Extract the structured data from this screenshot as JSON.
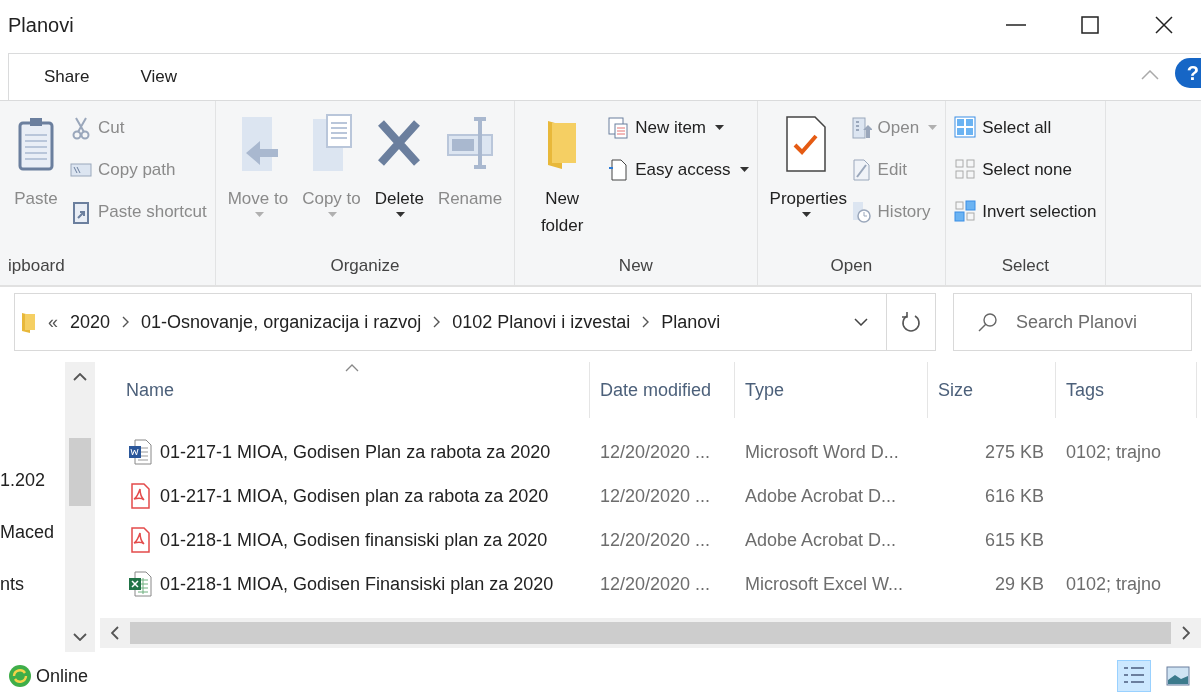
{
  "window": {
    "title": "Planovi"
  },
  "ribbon_tabs": [
    {
      "label": "Share",
      "selected": false
    },
    {
      "label": "View",
      "selected": false
    }
  ],
  "help": "?",
  "ribbon": [
    {
      "label": "ipboard",
      "items": [
        {
          "kind": "large",
          "label": "Paste",
          "disabled": true
        },
        {
          "kind": "small",
          "label": "Cut",
          "disabled": true
        },
        {
          "kind": "small",
          "label": "Copy path",
          "disabled": true
        },
        {
          "kind": "small",
          "label": "Paste shortcut",
          "disabled": true
        }
      ]
    },
    {
      "label": "Organize",
      "items": [
        {
          "kind": "large",
          "label": "Move to",
          "disabled": true,
          "dropdown": true
        },
        {
          "kind": "large",
          "label": "Copy to",
          "disabled": true,
          "dropdown": true
        },
        {
          "kind": "large",
          "label": "Delete",
          "disabled": false,
          "dropdown": true
        },
        {
          "kind": "large",
          "label": "Rename",
          "disabled": true
        }
      ]
    },
    {
      "label": "New",
      "items": [
        {
          "kind": "large",
          "label": "New folder",
          "disabled": false
        },
        {
          "kind": "small",
          "label": "New item",
          "disabled": false,
          "dropdown": true
        },
        {
          "kind": "small",
          "label": "Easy access",
          "disabled": false,
          "dropdown": true
        }
      ]
    },
    {
      "label": "Open",
      "items": [
        {
          "kind": "large",
          "label": "Properties",
          "disabled": false,
          "dropdown": true
        },
        {
          "kind": "small",
          "label": "Open",
          "disabled": true,
          "dropdown": true
        },
        {
          "kind": "small",
          "label": "Edit",
          "disabled": true
        },
        {
          "kind": "small",
          "label": "History",
          "disabled": true
        }
      ]
    },
    {
      "label": "Select",
      "items": [
        {
          "kind": "small",
          "label": "Select all",
          "disabled": false
        },
        {
          "kind": "small",
          "label": "Select none",
          "disabled": false
        },
        {
          "kind": "small",
          "label": "Invert selection",
          "disabled": false
        }
      ]
    }
  ],
  "address": {
    "overflow": "«",
    "crumbs": [
      "2020",
      "01-Osnovanje, organizacija i razvoj",
      "0102 Planovi i izvestai",
      "Planovi"
    ]
  },
  "search": {
    "placeholder": "Search Planovi"
  },
  "nav_pane": {
    "items": [
      {
        "label": "1.202"
      },
      {
        "label": "Maced"
      },
      {
        "label": "nts"
      }
    ]
  },
  "columns": [
    "Name",
    "Date modified",
    "Type",
    "Size",
    "Tags"
  ],
  "files": [
    {
      "kind": "word",
      "name": "01-217-1 MIOA, Godisen Plan za rabota za 2020",
      "date": "12/20/2020 ...",
      "type": "Microsoft Word D...",
      "size": "275 KB",
      "tags": "0102; trajno"
    },
    {
      "kind": "pdf",
      "name": "01-217-1 MIOA, Godisen plan za rabota za 2020",
      "date": "12/20/2020 ...",
      "type": "Adobe Acrobat D...",
      "size": "616 KB"
    },
    {
      "kind": "pdf",
      "name": "01-218-1 MIOA, Godisen finansiski plan za 2020",
      "date": "12/20/2020 ...",
      "type": "Adobe Acrobat D...",
      "size": "615 KB"
    },
    {
      "kind": "excel",
      "name": "01-218-1 MIOA, Godisen Finansiski plan za 2020",
      "date": "12/20/2020 ...",
      "type": "Microsoft Excel W...",
      "size": "29 KB",
      "tags": "0102; trajno"
    }
  ],
  "status_bar": {
    "status": "Online",
    "views": [
      {
        "selected": true
      },
      {
        "selected": false
      }
    ]
  }
}
